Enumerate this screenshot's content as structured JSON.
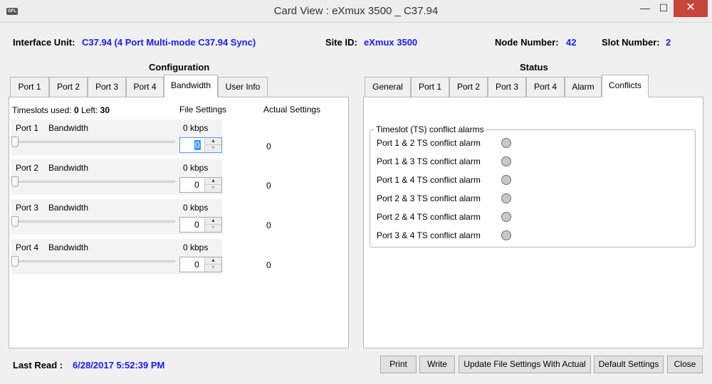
{
  "window": {
    "title": "Card View : eXmux 3500 _ C37.94",
    "icon_text": "GFL",
    "minimize": "—",
    "maximize": "☐",
    "close": "✕"
  },
  "header": {
    "interface_unit_label": "Interface Unit:",
    "interface_unit_value": "C37.94 (4 Port Multi-mode C37.94 Sync)",
    "site_id_label": "Site ID:",
    "site_id_value": "eXmux 3500",
    "node_number_label": "Node Number:",
    "node_number_value": "42",
    "slot_number_label": "Slot Number:",
    "slot_number_value": "2"
  },
  "configuration": {
    "title": "Configuration",
    "tabs": [
      "Port 1",
      "Port 2",
      "Port 3",
      "Port 4",
      "Bandwidth",
      "User Info"
    ],
    "active_tab": "Bandwidth",
    "timeslots_used_label": "Timeslots used:",
    "timeslots_used_value": "0",
    "left_label": "Left:",
    "left_value": "30",
    "file_settings_header": "File Settings",
    "actual_settings_header": "Actual Settings",
    "bandwidth_label": "Bandwidth",
    "ports": [
      {
        "name": "Port 1",
        "kbps": "0 kbps",
        "value": "0",
        "actual": "0",
        "slider_level": 0
      },
      {
        "name": "Port 2",
        "kbps": "0 kbps",
        "value": "0",
        "actual": "0",
        "slider_level": 0
      },
      {
        "name": "Port 3",
        "kbps": "0 kbps",
        "value": "0",
        "actual": "0",
        "slider_level": 0
      },
      {
        "name": "Port 4",
        "kbps": "0 kbps",
        "value": "0",
        "actual": "0",
        "slider_level": 0
      }
    ],
    "spin_up": "▲",
    "spin_down": "▼"
  },
  "status": {
    "title": "Status",
    "tabs": [
      "General",
      "Port 1",
      "Port 2",
      "Port 3",
      "Port 4",
      "Alarm",
      "Conflicts"
    ],
    "active_tab": "Conflicts",
    "group_title": "Timeslot (TS) conflict alarms",
    "alarms": [
      "Port 1 & 2 TS conflict alarm",
      "Port 1 & 3 TS conflict alarm",
      "Port 1 & 4 TS conflict alarm",
      "Port 2 & 3 TS conflict alarm",
      "Port 2 & 4 TS conflict alarm",
      "Port 3 & 4 TS conflict alarm"
    ],
    "led_color": "#c8c8c8"
  },
  "footer": {
    "last_read_label": "Last Read :",
    "last_read_value": "6/28/2017 5:52:39 PM",
    "buttons": [
      "Print",
      "Write",
      "Update File Settings With Actual",
      "Default Settings",
      "Close"
    ]
  }
}
